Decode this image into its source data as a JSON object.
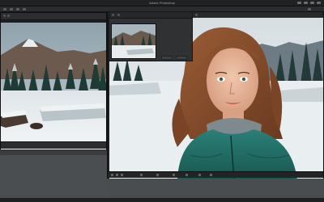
{
  "window": {
    "title": "Adobe Photoshop"
  },
  "left_document": {
    "tab_label": "",
    "image": "snowy-forest-scene"
  },
  "right_document": {
    "image": "woman-portrait-winter"
  },
  "navigator": {
    "thumbnail": "snowy-forest-thumbnail",
    "buttons": [
      "",
      ""
    ]
  },
  "icons": {
    "top_right": [
      "search-icon",
      "settings-icon",
      "window-icon",
      "minimize-icon"
    ]
  },
  "colors": {
    "workspace_bg": "#3c3e40",
    "panel_bg": "#2f3133",
    "accent_jacket": "#1f6f6a"
  }
}
